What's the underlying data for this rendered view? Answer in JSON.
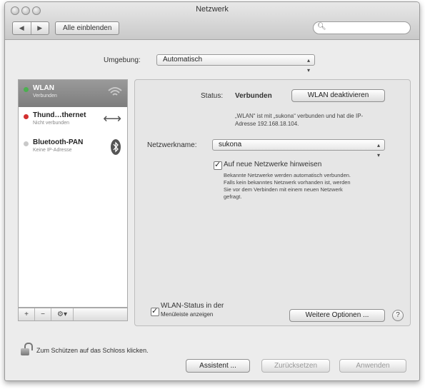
{
  "window": {
    "title": "Netzwerk"
  },
  "toolbar": {
    "back_glyph": "◀",
    "forward_glyph": "▶",
    "show_all": "Alle einblenden",
    "search_placeholder": "",
    "search_icon": "magnifier-icon"
  },
  "location": {
    "label": "Umgebung:",
    "value": "Automatisch"
  },
  "services": [
    {
      "name": "WLAN",
      "status": "Verbunden",
      "status_color": "#4caf50",
      "icon": "wifi-icon",
      "selected": true
    },
    {
      "name": "Thund…thernet",
      "status": "Nicht verbunden",
      "status_color": "#d32f2f",
      "icon": "ethernet-arrows-icon",
      "icon_glyph": "⟷",
      "selected": false
    },
    {
      "name": "Bluetooth-PAN",
      "status": "Keine IP-Adresse",
      "status_color": "#c9c9c9",
      "icon": "bluetooth-icon",
      "icon_glyph": "✱",
      "selected": false
    }
  ],
  "sidebar_actions": {
    "add": "+",
    "remove": "−",
    "gear": "⚙▾"
  },
  "detail": {
    "status_label": "Status:",
    "status_value": "Verbunden",
    "toggle_button": "WLAN deaktivieren",
    "status_info_line1": "„WLAN“ ist mit „sukona“ verbunden und hat die IP-",
    "status_info_line2": "Adresse 192.168.18.104.",
    "network_name_label": "Netzwerkname:",
    "network_name_value": "sukona",
    "ask_new_networks_label": "Auf neue Netzwerke hinweisen",
    "ask_new_networks_checked": true,
    "ask_info_line1": "Bekannte Netzwerke werden automatisch verbunden.",
    "ask_info_line2": "Falls kein bekanntes Netzwerk vorhanden ist, werden",
    "ask_info_line3": "Sie vor dem Verbinden mit einem neuen Netzwerk",
    "ask_info_line4": "gefragt.",
    "menubar_status_line1": "WLAN-Status in der",
    "menubar_status_line2": "Menüleiste anzeigen",
    "menubar_status_checked": true,
    "advanced_button": "Weitere Optionen ...",
    "help": "?"
  },
  "footer": {
    "lock_text": "Zum Schützen auf das Schloss klicken.",
    "assistant_button": "Assistent ...",
    "revert_button": "Zurücksetzen",
    "apply_button": "Anwenden"
  }
}
